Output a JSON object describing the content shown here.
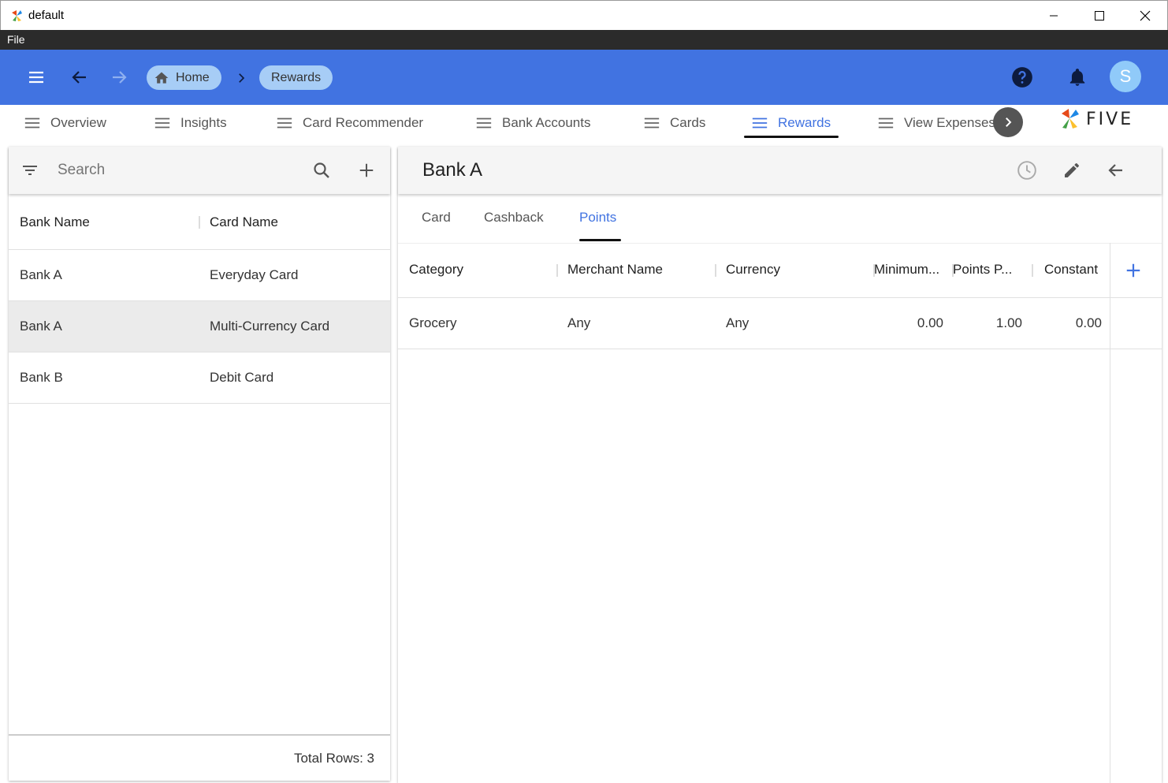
{
  "window": {
    "title": "default"
  },
  "menubar": {
    "file": "File"
  },
  "header": {
    "breadcrumbs": [
      {
        "label": "Home"
      },
      {
        "label": "Rewards"
      }
    ],
    "avatar_initial": "S",
    "accent_color": "#4173e1"
  },
  "nav": {
    "tabs": [
      {
        "label": "Overview"
      },
      {
        "label": "Insights"
      },
      {
        "label": "Card Recommender"
      },
      {
        "label": "Bank Accounts"
      },
      {
        "label": "Cards"
      },
      {
        "label": "Rewards",
        "active": true
      },
      {
        "label": "View Expenses"
      }
    ],
    "brand": "FIVE"
  },
  "left_panel": {
    "search_placeholder": "Search",
    "columns": [
      "Bank Name",
      "Card Name"
    ],
    "rows": [
      {
        "bank": "Bank A",
        "card": "Everyday Card",
        "selected": false
      },
      {
        "bank": "Bank A",
        "card": "Multi-Currency Card",
        "selected": true
      },
      {
        "bank": "Bank B",
        "card": "Debit Card",
        "selected": false
      }
    ],
    "footer": "Total Rows: 3"
  },
  "detail": {
    "title": "Bank A",
    "tabs": [
      {
        "label": "Card"
      },
      {
        "label": "Cashback"
      },
      {
        "label": "Points",
        "active": true
      }
    ],
    "columns": [
      "Category",
      "Merchant Name",
      "Currency",
      "Minimum...",
      "Points P...",
      "Constant"
    ],
    "rows": [
      {
        "category": "Grocery",
        "merchant": "Any",
        "currency": "Any",
        "minimum": "0.00",
        "points": "1.00",
        "constant": "0.00"
      }
    ]
  }
}
